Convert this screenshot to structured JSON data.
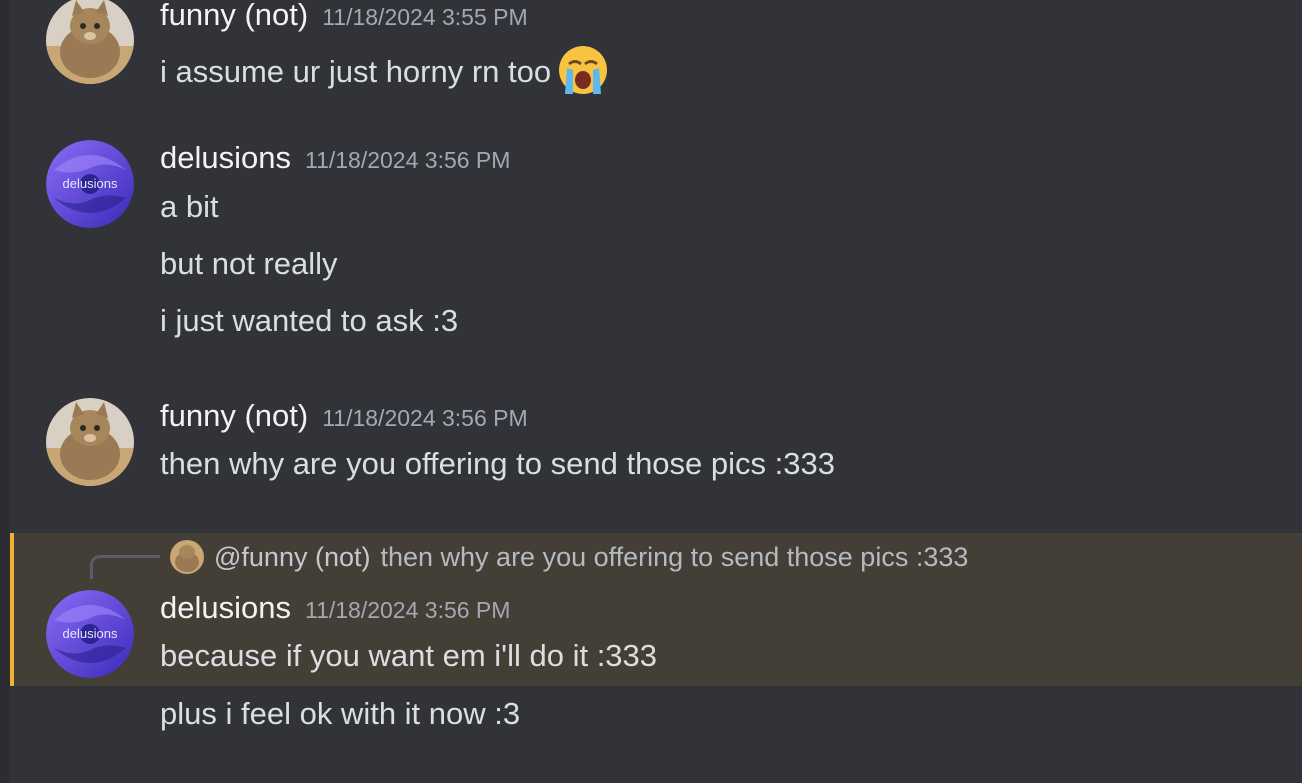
{
  "messages": [
    {
      "username": "funny (not)",
      "timestamp": "11/18/2024 3:55 PM",
      "lines": [
        "i assume ur just horny rn too"
      ],
      "emoji": "loudly-crying-face-emoji"
    },
    {
      "username": "delusions",
      "avatar_text": "delusions",
      "timestamp": "11/18/2024 3:56 PM",
      "lines": [
        "a bit",
        "but not really",
        "i just wanted to ask :3"
      ]
    },
    {
      "username": "funny (not)",
      "timestamp": "11/18/2024 3:56 PM",
      "lines": [
        "then why are you offering to send those pics :333"
      ]
    },
    {
      "username": "delusions",
      "avatar_text": "delusions",
      "timestamp": "11/18/2024 3:56 PM",
      "reply": {
        "mention": "@funny (not)",
        "text": "then why are you offering to send those pics :333"
      },
      "lines": [
        "because if you want em i'll do it :333",
        "plus i feel ok with it now :3"
      ]
    }
  ],
  "colors": {
    "background": "#313338",
    "highlight": "#433f37",
    "highlight_bar": "#f0b232",
    "username": "#f2f3f5",
    "timestamp": "#a5a8b0",
    "text": "#dbdee1"
  }
}
